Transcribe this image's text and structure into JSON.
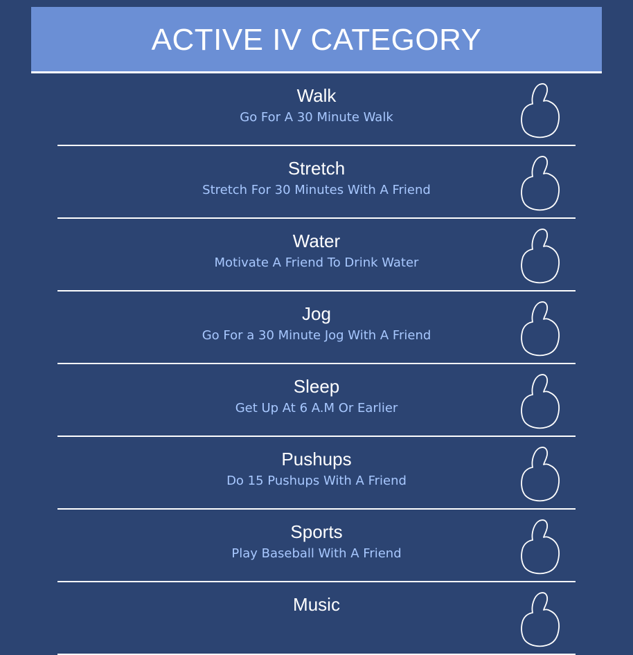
{
  "header": {
    "title": "ACTIVE IV CATEGORY"
  },
  "colors": {
    "background": "#2c4472",
    "header_bg": "#6b8fd5",
    "title_text": "#ffffff",
    "description_text": "#a8c8ff",
    "divider": "#ffffff"
  },
  "activities": [
    {
      "title": "Walk",
      "description": "Go For A 30 Minute Walk",
      "icon": "thumbs-up-icon"
    },
    {
      "title": "Stretch",
      "description": "Stretch For 30 Minutes With A Friend",
      "icon": "thumbs-up-icon"
    },
    {
      "title": "Water",
      "description": "Motivate A Friend To Drink Water",
      "icon": "thumbs-up-icon"
    },
    {
      "title": "Jog",
      "description": "Go For a 30 Minute Jog With A Friend",
      "icon": "thumbs-up-icon"
    },
    {
      "title": "Sleep",
      "description": "Get Up At 6 A.M Or Earlier",
      "icon": "thumbs-up-icon"
    },
    {
      "title": "Pushups",
      "description": "Do 15 Pushups With A Friend",
      "icon": "thumbs-up-icon"
    },
    {
      "title": "Sports",
      "description": "Play Baseball With A Friend",
      "icon": "thumbs-up-icon"
    },
    {
      "title": "Music",
      "description": "",
      "icon": "thumbs-up-icon"
    }
  ]
}
